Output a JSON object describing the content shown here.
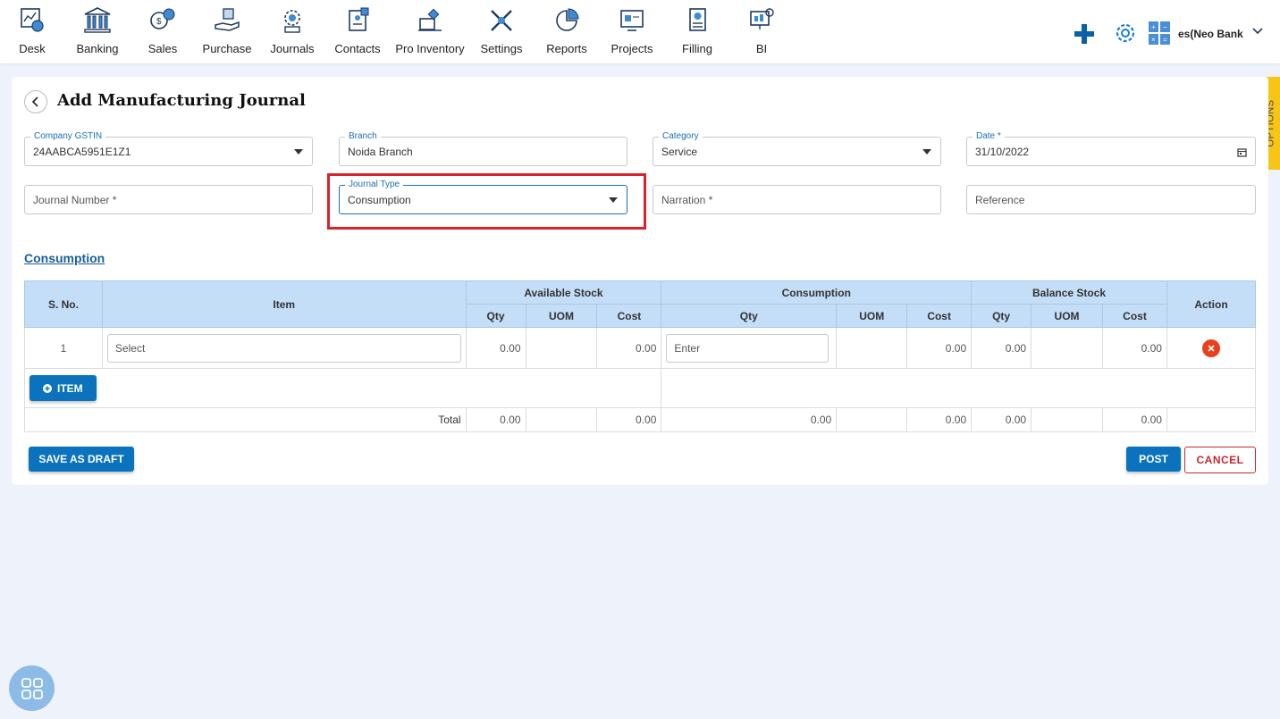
{
  "topnav": {
    "items": [
      {
        "label": "Desk",
        "icon": "desk-icon"
      },
      {
        "label": "Banking",
        "icon": "bank-icon"
      },
      {
        "label": "Sales",
        "icon": "sales-icon"
      },
      {
        "label": "Purchase",
        "icon": "purchase-icon"
      },
      {
        "label": "Journals",
        "icon": "journals-icon"
      },
      {
        "label": "Contacts",
        "icon": "contacts-icon"
      },
      {
        "label": "Pro Inventory",
        "icon": "inventory-icon"
      },
      {
        "label": "Settings",
        "icon": "settings-tools-icon"
      },
      {
        "label": "Reports",
        "icon": "reports-icon"
      },
      {
        "label": "Projects",
        "icon": "projects-icon"
      },
      {
        "label": "Filling",
        "icon": "filling-icon"
      },
      {
        "label": "BI",
        "icon": "bi-icon"
      }
    ],
    "company_name": "es(Neo Bank"
  },
  "page": {
    "title": "Add Manufacturing Journal",
    "options_tab": "OPTIONS"
  },
  "form": {
    "company_gstin": {
      "label": "Company GSTIN",
      "value": "24AABCA5951E1Z1"
    },
    "branch": {
      "label": "Branch",
      "value": "Noida Branch"
    },
    "category": {
      "label": "Category",
      "value": "Service"
    },
    "date": {
      "label": "Date *",
      "value": "31/10/2022"
    },
    "journal_number": {
      "placeholder": "Journal Number *"
    },
    "journal_type": {
      "label": "Journal Type",
      "value": "Consumption"
    },
    "narration": {
      "placeholder": "Narration *"
    },
    "reference": {
      "placeholder": "Reference"
    }
  },
  "section": {
    "title": "Consumption"
  },
  "table": {
    "headers": {
      "sno": "S. No.",
      "item": "Item",
      "available_stock": "Available Stock",
      "consumption": "Consumption",
      "balance_stock": "Balance Stock",
      "action": "Action",
      "qty": "Qty",
      "uom": "UOM",
      "cost": "Cost"
    },
    "rows": [
      {
        "sno": "1",
        "item_placeholder": "Select",
        "avail_qty": "0.00",
        "avail_uom": "",
        "avail_cost": "0.00",
        "cons_qty_placeholder": "Enter",
        "cons_uom": "",
        "cons_cost": "0.00",
        "bal_qty": "0.00",
        "bal_uom": "",
        "bal_cost": "0.00"
      }
    ],
    "add_item_label": "ITEM",
    "total": {
      "label": "Total",
      "avail_qty": "0.00",
      "avail_cost": "0.00",
      "cons_qty": "0.00",
      "cons_cost": "0.00",
      "bal_qty": "0.00",
      "bal_cost": "0.00"
    }
  },
  "actions": {
    "save_draft": "SAVE AS DRAFT",
    "post": "POST",
    "cancel": "CANCEL"
  },
  "colors": {
    "primary": "#0b72bd",
    "table_header": "#c4def8",
    "cancel": "#c8282d",
    "highlight": "#d9222a",
    "options_tab": "#f6c518"
  }
}
